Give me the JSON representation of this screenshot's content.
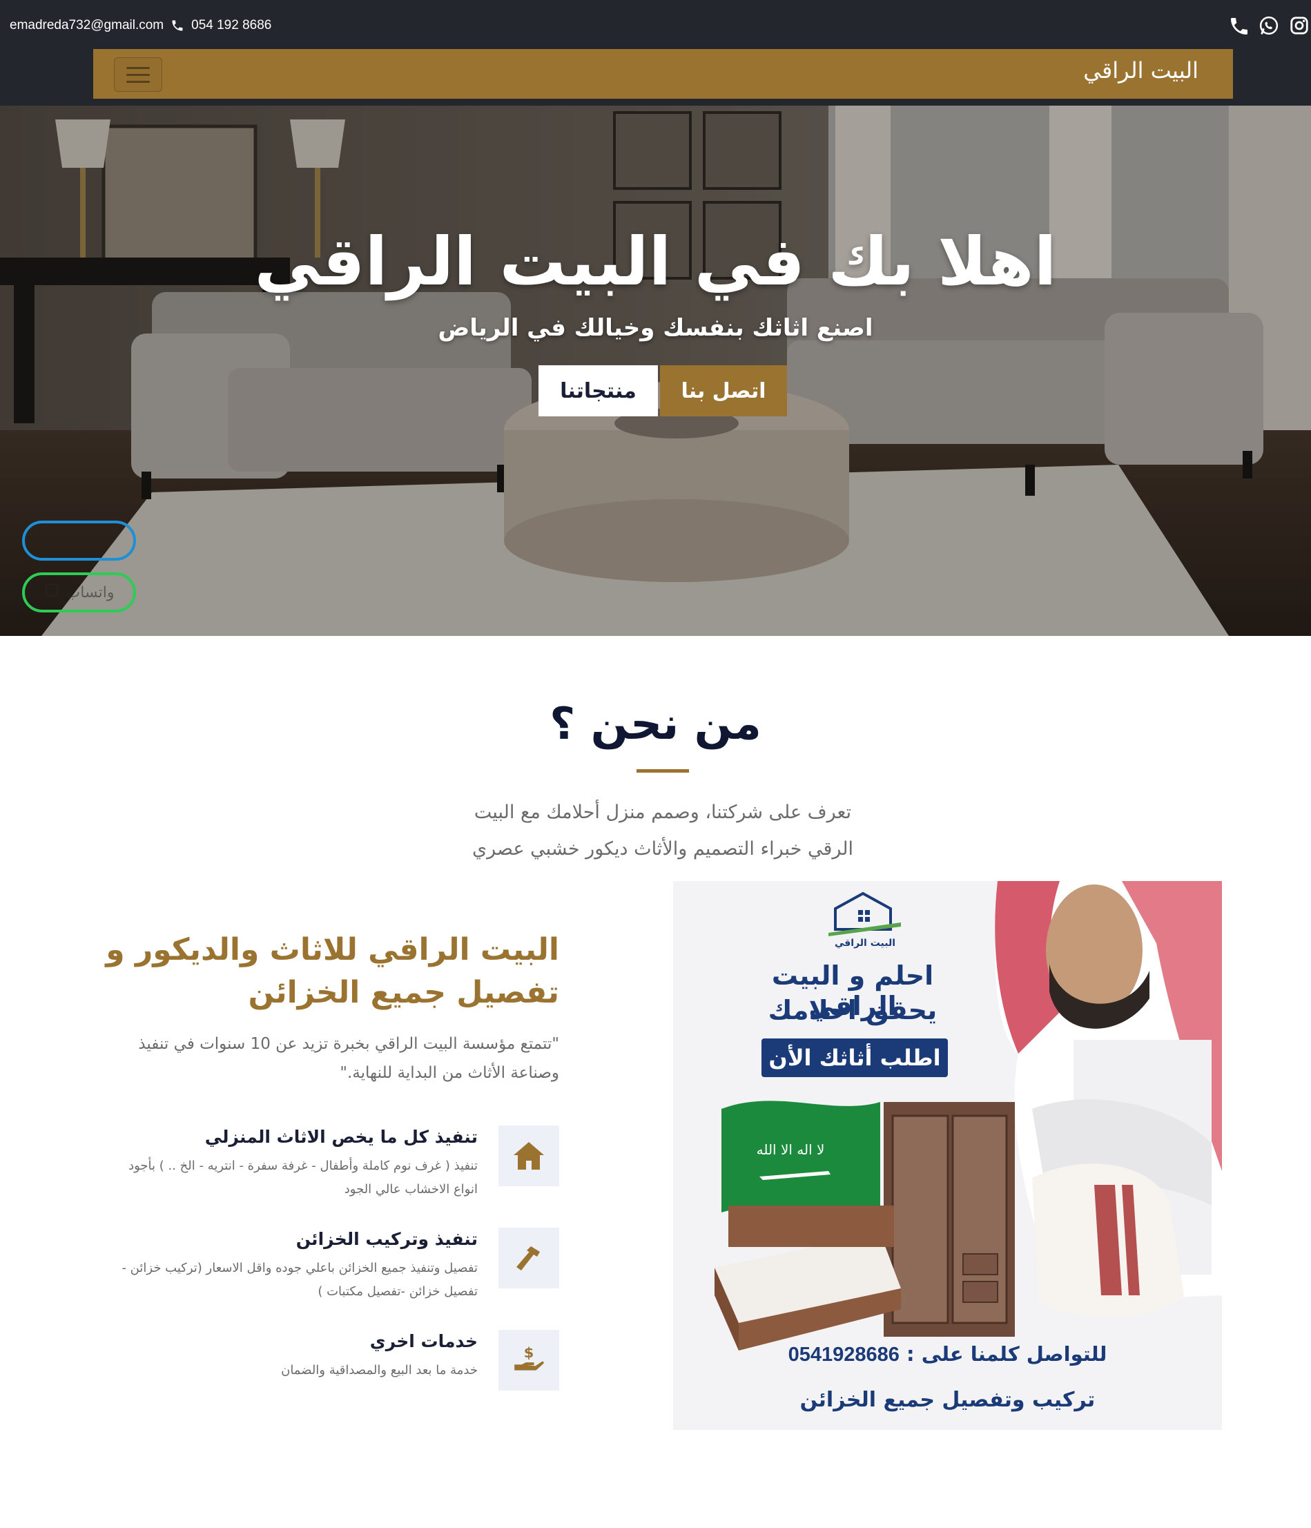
{
  "topbar": {
    "email": "emadreda732@gmail.com",
    "phone": "054 192 8686",
    "social_icons": [
      "phone-icon",
      "whatsapp-icon",
      "instagram-icon"
    ]
  },
  "navbar": {
    "brand": "البيت الراقي",
    "menu_icon": "hamburger-icon"
  },
  "hero": {
    "title": "اهلا بك في البيت الراقي",
    "subtitle": "اصنع اثاثك بنفسك وخيالك في الرياض",
    "contact_button": "اتصل بنا",
    "products_button": "منتجاتنا",
    "float_whatsapp_label": "واتساب"
  },
  "about": {
    "title": "من نحن ؟",
    "intro_line1": "تعرف على شركتنا، وصمم منزل أحلامك مع البيت",
    "intro_line2": "الرقي خبراء التصميم والأثاث ديكور خشبي عصري",
    "company_title": "البيت الراقي للاثاث والديكور و تفصيل جميع الخزائن",
    "company_desc": "\"تتمتع مؤسسة البيت الراقي بخبرة تزيد عن 10 سنوات في تنفيذ وصناعة الأثاث من البداية للنهاية.\"",
    "features": [
      {
        "icon": "home-icon",
        "title": "تنفيذ كل ما يخص الاثاث المنزلي",
        "desc": "تنفيذ ( غرف نوم كاملة وأطفال - غرفة سفرة - انتريه - الخ .. ) بأجود انواع الاخشاب عالي الجود"
      },
      {
        "icon": "hammer-icon",
        "title": "تنفيذ وتركيب الخزائن",
        "desc": "تفصيل وتنفيذ جميع الخزائن باعلي جوده واقل الاسعار (تركيب خزائن - تفصيل خزائن -تفصيل مكتبات )"
      },
      {
        "icon": "hand-money-icon",
        "title": "خدمات اخري",
        "desc": "خدمة ما بعد البيع والمصداقية والضمان"
      }
    ]
  },
  "promo": {
    "brand": "البيت الراقي",
    "headline1": "احلم و البيت الراقي",
    "headline2": "يحقق احلامك",
    "order_label": "اطلب أثاثك الأن",
    "call_label": "للتواصل كلمنا على :",
    "call_number": "0541928686",
    "install_label": "تركيب وتفصيل جميع الخزائن"
  },
  "colors": {
    "gold": "#9a7331",
    "dark": "#23262d",
    "navy": "#1b3a78",
    "whatsapp_border": "#2ecc55",
    "call_border": "#1f8fd8"
  }
}
